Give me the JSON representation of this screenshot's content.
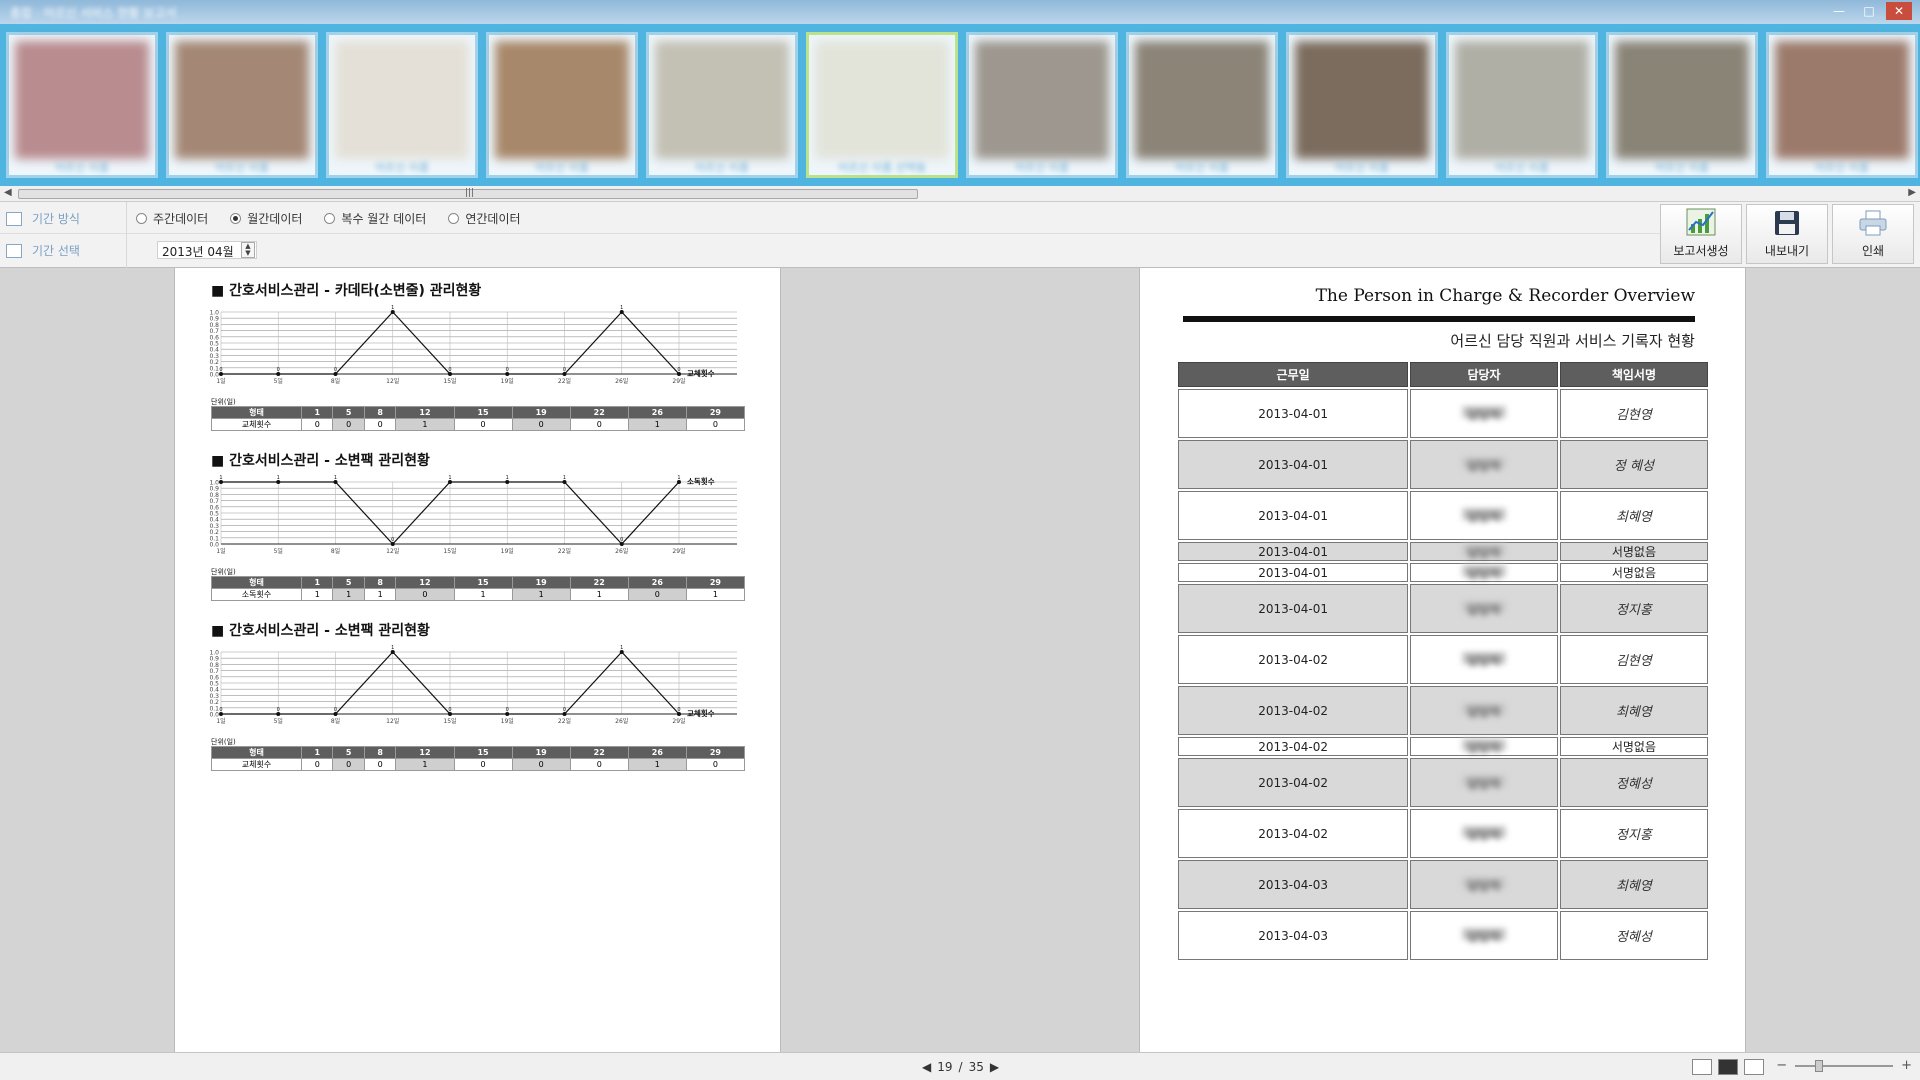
{
  "window": {
    "title": "종합 · 어르신 서비스 현황 보고서",
    "controls": [
      "—",
      "□",
      "✕"
    ]
  },
  "residents": [
    {
      "name": "어르신 이름",
      "photo_color": "#b98c8f"
    },
    {
      "name": "어르신 이름",
      "photo_color": "#a48775"
    },
    {
      "name": "어르신 이름",
      "photo_color": "#e4e0d7"
    },
    {
      "name": "어르신 이름",
      "photo_color": "#a8886a"
    },
    {
      "name": "어르신 이름",
      "photo_color": "#c3c0b4"
    },
    {
      "name": "어르신 이름 선택됨",
      "photo_color": "#e2e4da",
      "selected": true
    },
    {
      "name": "어르신 이름",
      "photo_color": "#9d978f"
    },
    {
      "name": "어르신 이름",
      "photo_color": "#8b8477"
    },
    {
      "name": "어르신 이름",
      "photo_color": "#7c6c5e"
    },
    {
      "name": "어르신 이름",
      "photo_color": "#b0afa6"
    },
    {
      "name": "어르신 이름",
      "photo_color": "#8a8477"
    },
    {
      "name": "어르신 이름",
      "photo_color": "#9c7a6b"
    }
  ],
  "toolbar": {
    "period_method_label": "기간 방식",
    "period_select_label": "기간 선택",
    "options": [
      "주간데이터",
      "월간데이터",
      "복수 월간 데이터",
      "연간데이터"
    ],
    "selected_option": "월간데이터",
    "period_value": "2013년 04월",
    "buttons": {
      "report": "보고서생성",
      "export": "내보내기",
      "print": "인쇄"
    }
  },
  "left_page": {
    "unit_label": "단위(일)",
    "sections": [
      {
        "title": "■ 간호서비스관리 - 카데타(소변줄) 관리현황",
        "series_label": "교체횟수",
        "row_header": "형태",
        "chart_data": {
          "type": "line",
          "x": [
            "1일",
            "5일",
            "8일",
            "12일",
            "15일",
            "19일",
            "22일",
            "26일",
            "29일"
          ],
          "values": [
            0,
            0,
            0,
            1,
            0,
            0,
            0,
            1,
            0
          ],
          "ylim": [
            0,
            1.0
          ],
          "yticks": [
            "0.0",
            "0.1",
            "0.2",
            "0.3",
            "0.4",
            "0.5",
            "0.6",
            "0.7",
            "0.8",
            "0.9",
            "1.0"
          ],
          "table_cols": [
            "1",
            "5",
            "8",
            "12",
            "15",
            "19",
            "22",
            "26",
            "29"
          ]
        }
      },
      {
        "title": "■ 간호서비스관리 - 소변팩 관리현황",
        "series_label": "소독횟수",
        "row_header": "형태",
        "chart_data": {
          "type": "line",
          "x": [
            "1일",
            "5일",
            "8일",
            "12일",
            "15일",
            "19일",
            "22일",
            "26일",
            "29일"
          ],
          "values": [
            1,
            1,
            1,
            0,
            1,
            1,
            1,
            0,
            1
          ],
          "ylim": [
            0,
            1.0
          ],
          "yticks": [
            "0.0",
            "0.1",
            "0.2",
            "0.3",
            "0.4",
            "0.5",
            "0.6",
            "0.7",
            "0.8",
            "0.9",
            "1.0"
          ],
          "table_cols": [
            "1",
            "5",
            "8",
            "12",
            "15",
            "19",
            "22",
            "26",
            "29"
          ]
        }
      },
      {
        "title": "■ 간호서비스관리 - 소변팩 관리현황",
        "series_label": "교체횟수",
        "row_header": "형태",
        "chart_data": {
          "type": "line",
          "x": [
            "1일",
            "5일",
            "8일",
            "12일",
            "15일",
            "19일",
            "22일",
            "26일",
            "29일"
          ],
          "values": [
            0,
            0,
            0,
            1,
            0,
            0,
            0,
            1,
            0
          ],
          "ylim": [
            0,
            1.0
          ],
          "yticks": [
            "0.0",
            "0.1",
            "0.2",
            "0.3",
            "0.4",
            "0.5",
            "0.6",
            "0.7",
            "0.8",
            "0.9",
            "1.0"
          ],
          "table_cols": [
            "1",
            "5",
            "8",
            "12",
            "15",
            "19",
            "22",
            "26",
            "29"
          ]
        }
      }
    ]
  },
  "right_page": {
    "title": "The Person in Charge & Recorder Overview",
    "subtitle": "어르신 담당 직원과 서비스 기록자 현황",
    "headers": [
      "근무일",
      "담당자",
      "책임서명"
    ],
    "rows": [
      {
        "date": "2013-04-01",
        "staff": "담당자",
        "sign": "김현영",
        "tall": true
      },
      {
        "date": "2013-04-01",
        "staff": "담당자",
        "sign": "정 혜성",
        "tall": true
      },
      {
        "date": "2013-04-01",
        "staff": "담당자",
        "sign": "최혜영",
        "tall": true
      },
      {
        "date": "2013-04-01",
        "staff": "담당자",
        "sign": "서명없음",
        "tall": false
      },
      {
        "date": "2013-04-01",
        "staff": "담당자",
        "sign": "서명없음",
        "tall": false
      },
      {
        "date": "2013-04-01",
        "staff": "담당자",
        "sign": "정지홍",
        "tall": true
      },
      {
        "date": "2013-04-02",
        "staff": "담당자",
        "sign": "김현영",
        "tall": true
      },
      {
        "date": "2013-04-02",
        "staff": "담당자",
        "sign": "최혜영",
        "tall": true
      },
      {
        "date": "2013-04-02",
        "staff": "담당자",
        "sign": "서명없음",
        "tall": false
      },
      {
        "date": "2013-04-02",
        "staff": "담당자",
        "sign": "정혜성",
        "tall": true
      },
      {
        "date": "2013-04-02",
        "staff": "담당자",
        "sign": "정지홍",
        "tall": true
      },
      {
        "date": "2013-04-03",
        "staff": "담당자",
        "sign": "최혜영",
        "tall": true
      },
      {
        "date": "2013-04-03",
        "staff": "담당자",
        "sign": "정혜성",
        "tall": true
      }
    ]
  },
  "status": {
    "current_page": "19",
    "separator": "/",
    "total_pages": "35",
    "prev": "◀",
    "next": "▶",
    "zoom_minus": "−",
    "zoom_plus": "+"
  }
}
